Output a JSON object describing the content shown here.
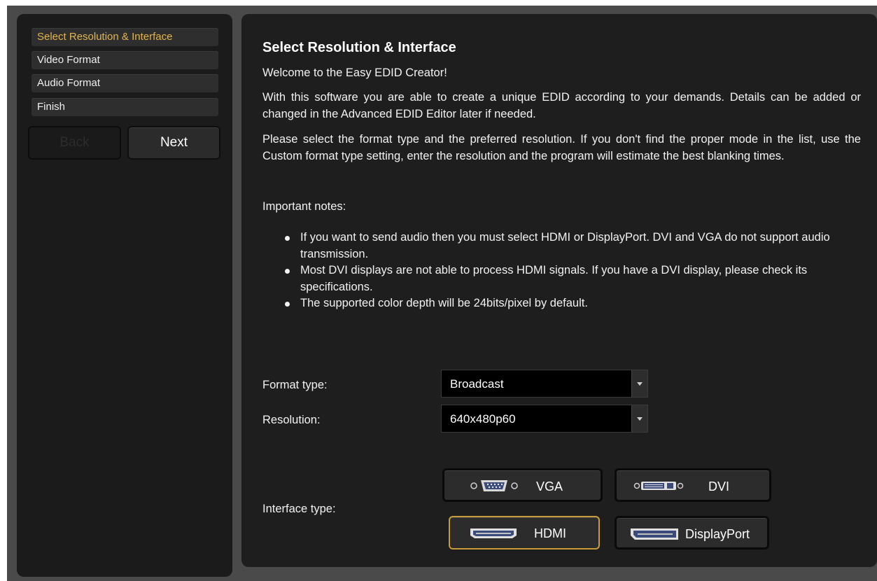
{
  "steps": [
    {
      "label": "Select Resolution & Interface",
      "active": true
    },
    {
      "label": "Video Format",
      "active": false
    },
    {
      "label": "Audio Format",
      "active": false
    },
    {
      "label": "Finish",
      "active": false
    }
  ],
  "nav": {
    "back_label": "Back",
    "next_label": "Next"
  },
  "content": {
    "title": "Select Resolution & Interface",
    "welcome": "Welcome to the Easy EDID Creator!",
    "para1": "With this software you are able to create a unique EDID according to your demands. Details can be added or changed in the Advanced EDID Editor later if needed.",
    "para2": "Please select the format type and the preferred resolution. If you don't find the proper mode in the list, use the Custom format type setting, enter the resolution and the program will estimate the best blanking times.",
    "notes_heading": "Important notes:",
    "notes": [
      "If you want to send audio then you must select HDMI or DisplayPort. DVI and VGA do not support audio transmission.",
      "Most DVI displays are not able to process HDMI signals. If you have a DVI display, please check its specifications.",
      "The supported color depth will be 24bits/pixel by default."
    ]
  },
  "form": {
    "format_label": "Format type:",
    "format_value": "Broadcast",
    "resolution_label": "Resolution:",
    "resolution_value": "640x480p60",
    "interface_label": "Interface type:"
  },
  "interfaces": [
    {
      "label": "VGA",
      "icon": "vga-connector-icon",
      "selected": false
    },
    {
      "label": "DVI",
      "icon": "dvi-connector-icon",
      "selected": false
    },
    {
      "label": "HDMI",
      "icon": "hdmi-connector-icon",
      "selected": true
    },
    {
      "label": "DisplayPort",
      "icon": "displayport-connector-icon",
      "selected": false
    }
  ],
  "colors": {
    "accent": "#e3b54c",
    "selected_border": "#c79b39",
    "panel": "#1e1e1e",
    "background": "#4a4a4a"
  }
}
